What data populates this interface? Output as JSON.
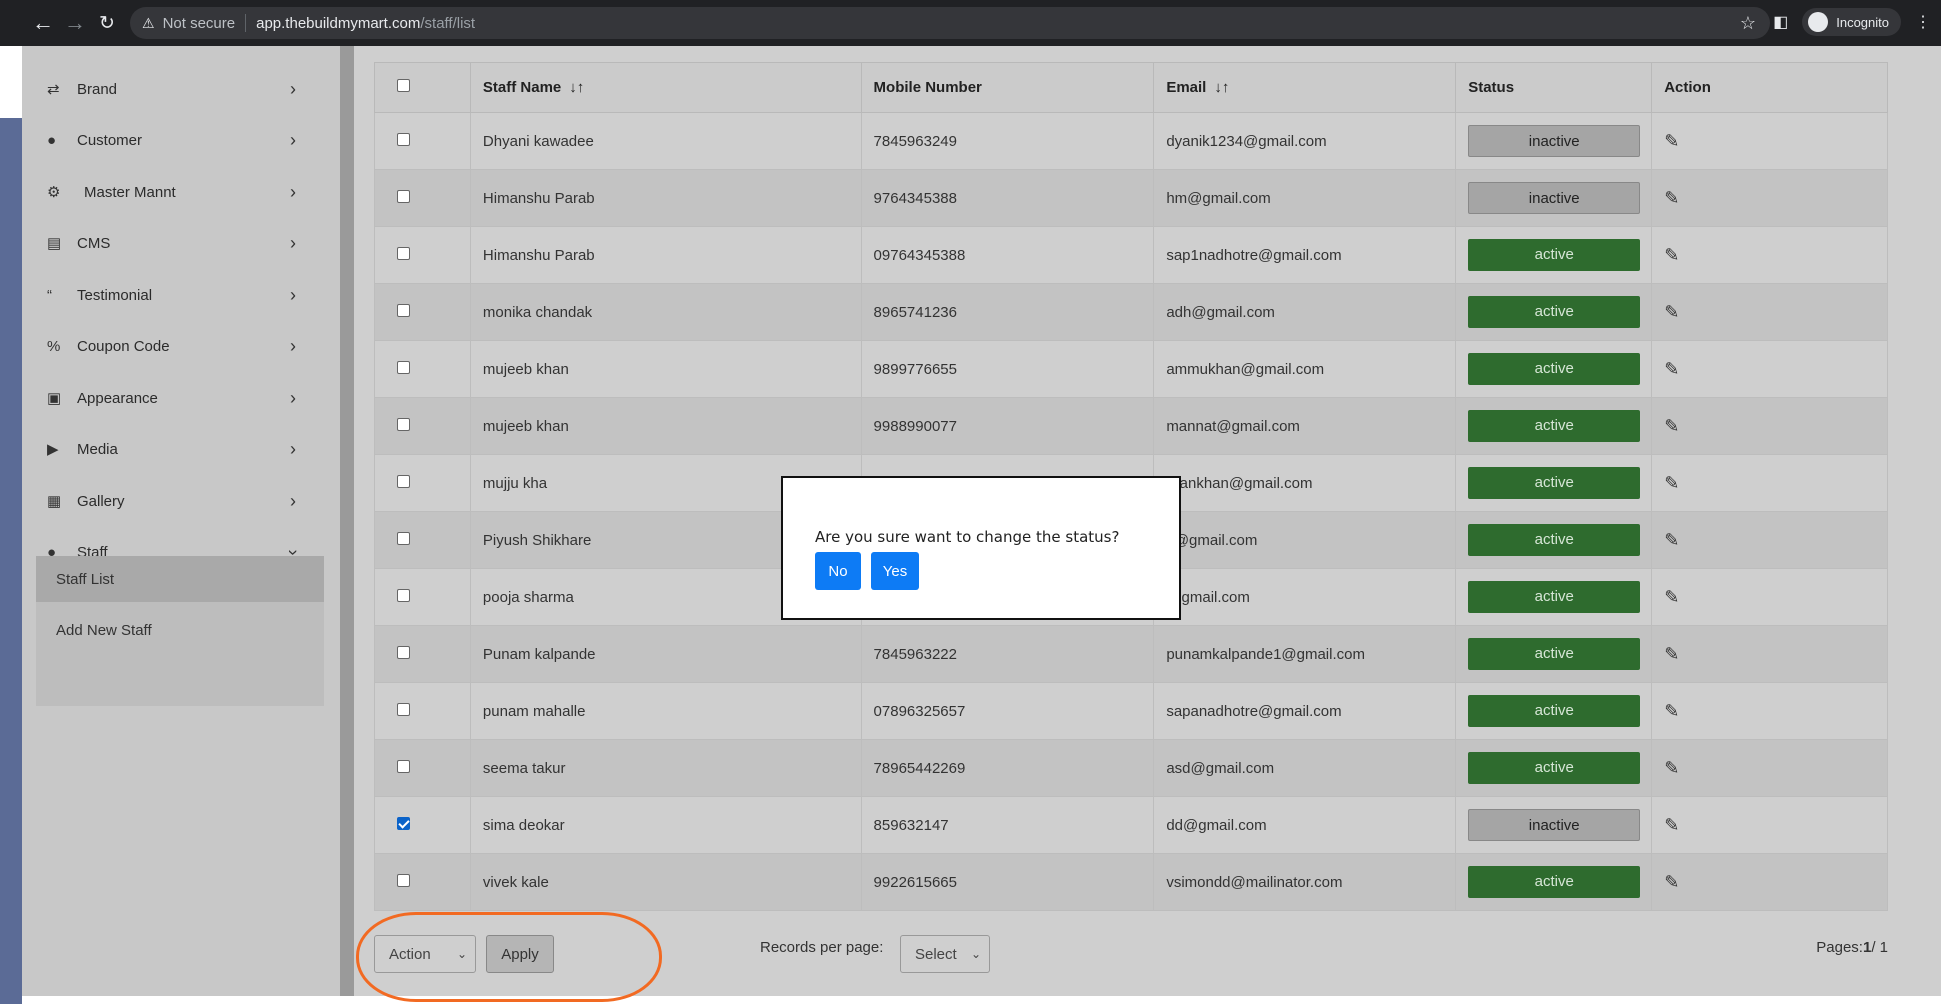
{
  "browser": {
    "back_icon": "arrow-left-icon",
    "forward_icon": "arrow-right-icon",
    "reload_icon": "reload-icon",
    "security_label": "Not secure",
    "url_host": "app.thebuildmymart.com",
    "url_path": "/staff/list",
    "incognito_label": "Incognito"
  },
  "sidebar": {
    "items": [
      {
        "label": "Brand",
        "icon": "shuffle-icon"
      },
      {
        "label": "Customer",
        "icon": "user-icon"
      },
      {
        "label": "Master Mannt",
        "icon": "user-gear-icon"
      },
      {
        "label": "CMS",
        "icon": "file-icon"
      },
      {
        "label": "Testimonial",
        "icon": "quote-icon"
      },
      {
        "label": "Coupon Code",
        "icon": "percent-icon"
      },
      {
        "label": "Appearance",
        "icon": "image-icon"
      },
      {
        "label": "Media",
        "icon": "play-circle-icon"
      },
      {
        "label": "Gallery",
        "icon": "images-icon"
      },
      {
        "label": "Staff",
        "icon": "user-icon"
      }
    ],
    "staff_sub": [
      {
        "label": "Staff List",
        "active": true
      },
      {
        "label": "Add New Staff",
        "active": false
      }
    ]
  },
  "table": {
    "headers": {
      "staff_name": "Staff Name",
      "mobile": "Mobile Number",
      "email": "Email",
      "status": "Status",
      "action": "Action"
    },
    "rows": [
      {
        "name": "Dhyani kawadee",
        "mobile": "7845963249",
        "email": "dyanik1234@gmail.com",
        "status": "inactive",
        "checked": false
      },
      {
        "name": "Himanshu Parab",
        "mobile": "9764345388",
        "email": "hm@gmail.com",
        "status": "inactive",
        "checked": false
      },
      {
        "name": "Himanshu Parab",
        "mobile": "09764345388",
        "email": "sap1nadhotre@gmail.com",
        "status": "active",
        "checked": false
      },
      {
        "name": "monika chandak",
        "mobile": "8965741236",
        "email": "adh@gmail.com",
        "status": "active",
        "checked": false
      },
      {
        "name": "mujeeb khan",
        "mobile": "9899776655",
        "email": "ammukhan@gmail.com",
        "status": "active",
        "checked": false
      },
      {
        "name": "mujeeb khan",
        "mobile": "9988990077",
        "email": "mannat@gmail.com",
        "status": "active",
        "checked": false
      },
      {
        "name": "mujju kha",
        "mobile": "",
        "email": "hrankhan@gmail.com",
        "status": "active",
        "checked": false
      },
      {
        "name": "Piyush Shikhare",
        "mobile": "",
        "email": "s@gmail.com",
        "status": "active",
        "checked": false
      },
      {
        "name": "pooja sharma",
        "mobile": "",
        "email": "@gmail.com",
        "status": "active",
        "checked": false
      },
      {
        "name": "Punam kalpande",
        "mobile": "7845963222",
        "email": "punamkalpande1@gmail.com",
        "status": "active",
        "checked": false
      },
      {
        "name": "punam mahalle",
        "mobile": "07896325657",
        "email": "sapanadhotre@gmail.com",
        "status": "active",
        "checked": false
      },
      {
        "name": "seema takur",
        "mobile": "78965442269",
        "email": "asd@gmail.com",
        "status": "active",
        "checked": false
      },
      {
        "name": "sima deokar",
        "mobile": "859632147",
        "email": "dd@gmail.com",
        "status": "inactive",
        "checked": true
      },
      {
        "name": "vivek kale",
        "mobile": "9922615665",
        "email": "vsimondd@mailinator.com",
        "status": "active",
        "checked": false
      }
    ]
  },
  "footer": {
    "action_select": "Action",
    "apply_label": "Apply",
    "records_label": "Records per page:",
    "records_select": "Select",
    "pages_prefix": "Pages:",
    "pages_current": "1",
    "pages_total": "/ 1"
  },
  "modal": {
    "message": "Are you sure want to change the status?",
    "no_label": "No",
    "yes_label": "Yes"
  },
  "colors": {
    "active_status": "#2e6b2e",
    "inactive_status": "#a5a5a5",
    "modal_button": "#0d7bf5",
    "annotation": "#f26a22"
  }
}
